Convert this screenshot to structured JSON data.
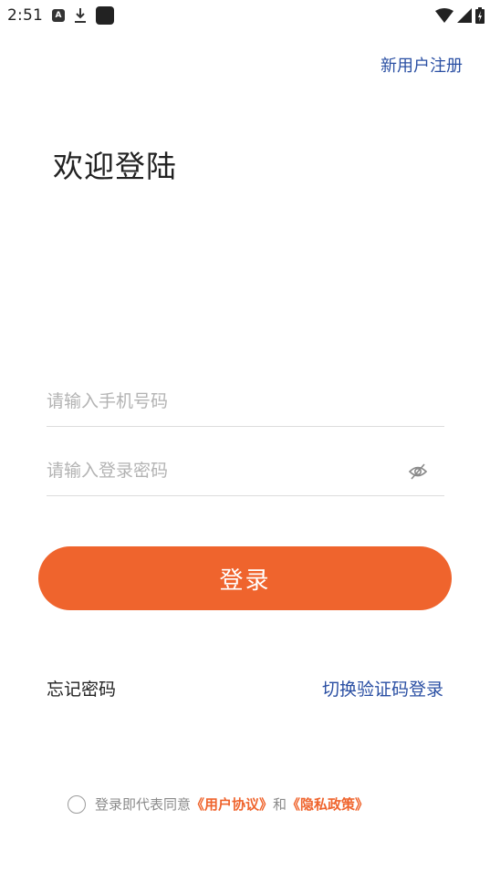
{
  "status_bar": {
    "time": "2:51",
    "icons": [
      "a-notification-icon",
      "download-icon",
      "app-square-icon",
      "wifi-icon",
      "signal-icon",
      "battery-charging-icon"
    ]
  },
  "header": {
    "register_label": "新用户注册"
  },
  "main": {
    "title": "欢迎登陆",
    "phone_placeholder": "请输入手机号码",
    "phone_value": "",
    "password_placeholder": "请输入登录密码",
    "password_value": "",
    "password_toggle_icon": "eye-off-icon",
    "login_label": "登录",
    "forgot_label": "忘记密码",
    "switch_label": "切换验证码登录"
  },
  "agreement": {
    "prefix": "登录即代表同意",
    "user_agreement": "《用户协议》",
    "and": "和",
    "privacy_policy": "《隐私政策》",
    "checked": false
  },
  "colors": {
    "accent": "#ef642d",
    "link_blue": "#2a4fa3",
    "text_dark": "#222222",
    "placeholder": "#b3b3b3",
    "divider": "#dcdcdc"
  }
}
